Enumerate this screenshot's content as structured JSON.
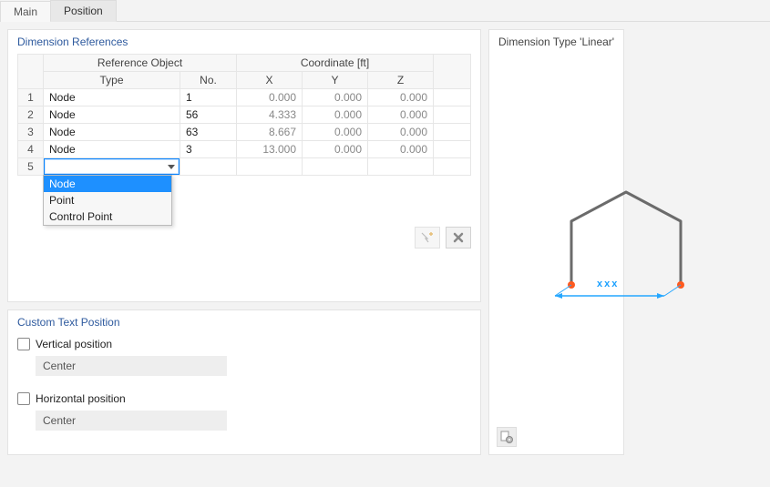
{
  "tabs": {
    "main": "Main",
    "position": "Position"
  },
  "refs": {
    "title": "Dimension References",
    "headers": {
      "ref_obj": "Reference Object",
      "coord": "Coordinate [ft]",
      "type": "Type",
      "no": "No.",
      "x": "X",
      "y": "Y",
      "z": "Z"
    },
    "rows": [
      {
        "idx": "1",
        "type": "Node",
        "no": "1",
        "x": "0.000",
        "y": "0.000",
        "z": "0.000"
      },
      {
        "idx": "2",
        "type": "Node",
        "no": "56",
        "x": "4.333",
        "y": "0.000",
        "z": "0.000"
      },
      {
        "idx": "3",
        "type": "Node",
        "no": "63",
        "x": "8.667",
        "y": "0.000",
        "z": "0.000"
      },
      {
        "idx": "4",
        "type": "Node",
        "no": "3",
        "x": "13.000",
        "y": "0.000",
        "z": "0.000"
      }
    ],
    "editing_row_idx": "5",
    "type_options": [
      "Node",
      "Point",
      "Control Point"
    ],
    "type_selected": "Node"
  },
  "ctp": {
    "title": "Custom Text Position",
    "vertical_label": "Vertical position",
    "vertical_value": "Center",
    "horizontal_label": "Horizontal position",
    "horizontal_value": "Center"
  },
  "preview": {
    "title": "Dimension Type 'Linear'",
    "dim_text": "xxx"
  }
}
